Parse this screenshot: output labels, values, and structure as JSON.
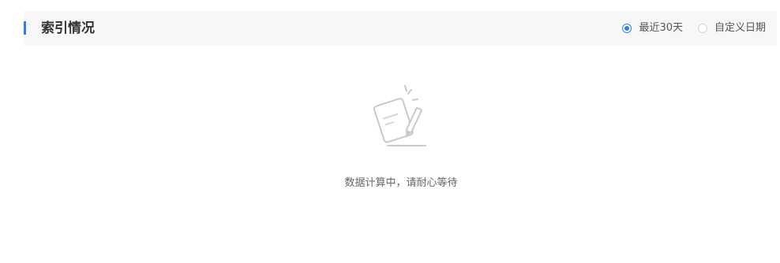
{
  "section": {
    "title": "索引情况"
  },
  "date_range": {
    "options": [
      {
        "label": "最近30天",
        "checked": true
      },
      {
        "label": "自定义日期",
        "checked": false
      }
    ]
  },
  "empty_state": {
    "message": "数据计算中，请耐心等待",
    "icon": "notepad-pen-icon"
  },
  "colors": {
    "accent": "#2f7ff0",
    "header_bg": "#f7f7f7"
  }
}
